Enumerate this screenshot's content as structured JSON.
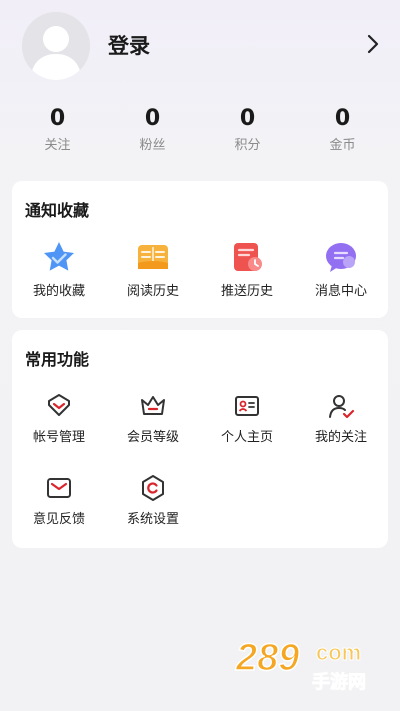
{
  "header": {
    "login_label": "登录"
  },
  "stats": [
    {
      "value": "0",
      "label": "关注"
    },
    {
      "value": "0",
      "label": "粉丝"
    },
    {
      "value": "0",
      "label": "积分"
    },
    {
      "value": "0",
      "label": "金币"
    }
  ],
  "notify_section": {
    "title": "通知收藏",
    "items": [
      {
        "label": "我的收藏",
        "icon": "star-icon"
      },
      {
        "label": "阅读历史",
        "icon": "book-icon"
      },
      {
        "label": "推送历史",
        "icon": "push-history-icon"
      },
      {
        "label": "消息中心",
        "icon": "message-icon"
      }
    ]
  },
  "common_section": {
    "title": "常用功能",
    "items": [
      {
        "label": "帐号管理",
        "icon": "account-icon"
      },
      {
        "label": "会员等级",
        "icon": "crown-icon"
      },
      {
        "label": "个人主页",
        "icon": "id-card-icon"
      },
      {
        "label": "我的关注",
        "icon": "follow-icon"
      },
      {
        "label": "意见反馈",
        "icon": "feedback-icon"
      },
      {
        "label": "系统设置",
        "icon": "settings-icon"
      }
    ]
  },
  "watermark": {
    "brand": "289",
    "suffix": "com",
    "subtitle": "手游网"
  },
  "colors": {
    "accent_red": "#d9262c",
    "star_blue": "#3d8cf2",
    "book_orange": "#f5a623",
    "push_red": "#ec4a4a",
    "message_purple": "#8b6cf0"
  }
}
